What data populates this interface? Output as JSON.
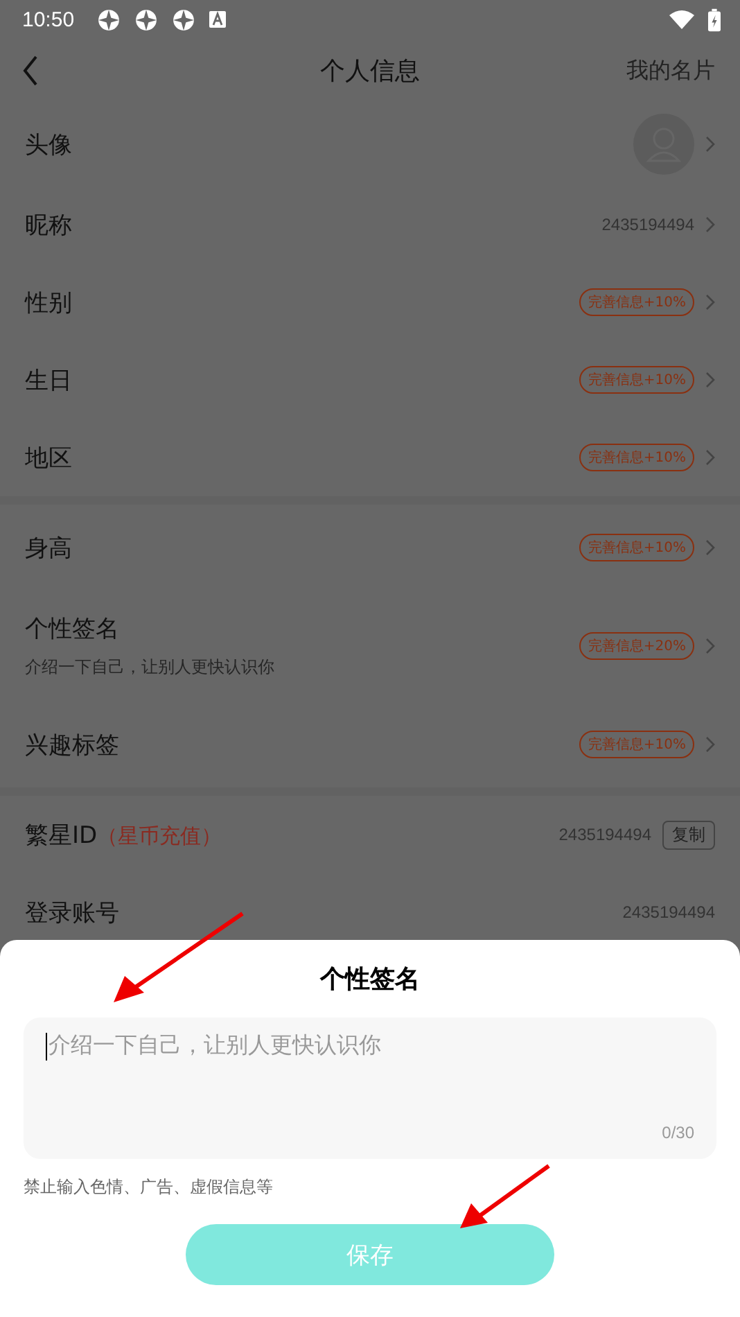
{
  "status_bar": {
    "time": "10:50"
  },
  "header": {
    "title": "个人信息",
    "action": "我的名片"
  },
  "sections": [
    {
      "rows": [
        {
          "kind": "avatar",
          "label": "头像",
          "chevron": true
        },
        {
          "kind": "value",
          "label": "昵称",
          "value": "2435194494",
          "chevron": true
        },
        {
          "kind": "badge",
          "label": "性别",
          "badge": "完善信息+10%",
          "chevron": true
        },
        {
          "kind": "badge",
          "label": "生日",
          "badge": "完善信息+10%",
          "chevron": true
        },
        {
          "kind": "badge",
          "label": "地区",
          "badge": "完善信息+10%",
          "chevron": true
        }
      ]
    },
    {
      "rows": [
        {
          "kind": "badge",
          "label": "身高",
          "badge": "完善信息+10%",
          "chevron": true
        },
        {
          "kind": "badge",
          "label": "个性签名",
          "subtitle": "介绍一下自己，让别人更快认识你",
          "badge": "完善信息+20%",
          "chevron": true
        },
        {
          "kind": "badge",
          "label": "兴趣标签",
          "badge": "完善信息+10%",
          "chevron": true
        }
      ]
    },
    {
      "rows": [
        {
          "kind": "id",
          "label": "繁星ID",
          "tag": "（星币充值）",
          "value": "2435194494",
          "button": "复制",
          "chevron": false
        },
        {
          "kind": "value",
          "label": "登录账号",
          "value": "2435194494",
          "chevron": false
        }
      ]
    }
  ],
  "sheet": {
    "title": "个性签名",
    "field": {
      "placeholder": "介绍一下自己，让别人更快认识你",
      "counter": "0/30"
    },
    "hint": "禁止输入色情、广告、虚假信息等",
    "button": "保存"
  }
}
